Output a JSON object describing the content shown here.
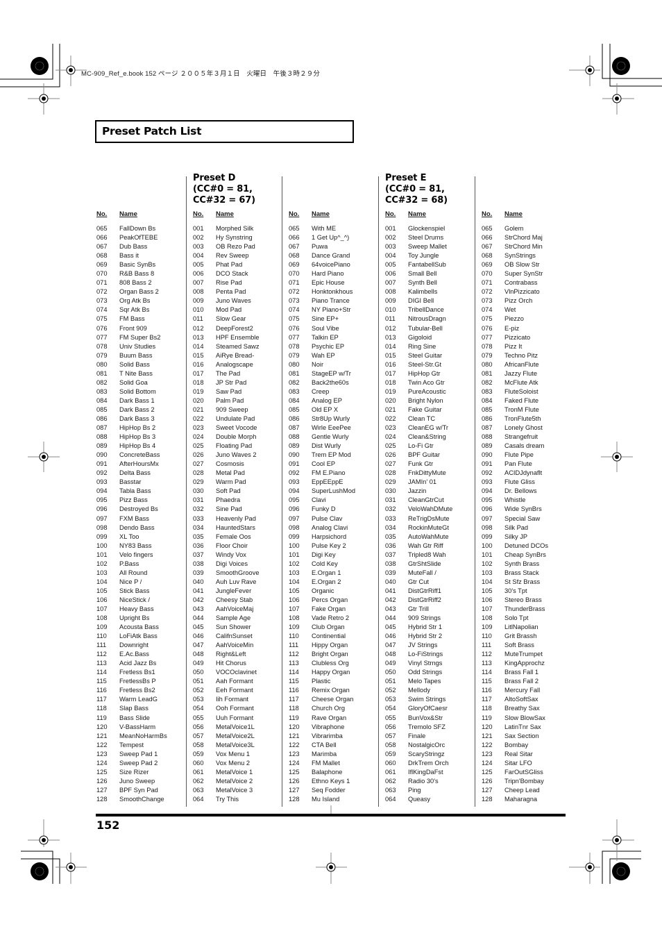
{
  "printer_line": "MC-909_Ref_e.book  152 ページ  ２００５年３月１日　火曜日　午後３時２９分",
  "section_title": "Preset Patch List",
  "page_number": "152",
  "column_headers": {
    "no": "No.",
    "name": "Name"
  },
  "presets": [
    {
      "title_line1": "Preset D",
      "title_line2": "(CC#0 = 81,",
      "title_line3": "CC#32 = 67)"
    },
    {
      "title_line1": "Preset E",
      "title_line2": "(CC#0 = 81,",
      "title_line3": "CC#32 = 68)"
    }
  ],
  "columns": [
    {
      "start": 65,
      "names": [
        "FallDown Bs",
        "PeakOfTEBE",
        "Dub Bass",
        "Bass it",
        "Basic SynBs",
        "R&B Bass 8",
        "808 Bass 2",
        "Organ Bass 2",
        "Org Atk Bs",
        "Sqr Atk Bs",
        "FM Bass",
        "Front 909",
        "FM Super Bs2",
        "Univ Studies",
        "Buum Bass",
        "Solid Bass",
        "T Nite Bass",
        "Solid Goa",
        "Solid Bottom",
        "Dark Bass 1",
        "Dark Bass 2",
        "Dark Bass 3",
        "HipHop Bs 2",
        "HipHop Bs 3",
        "HipHop Bs 4",
        "ConcreteBass",
        "AfterHoursMx",
        "Delta Bass",
        "Basstar",
        "Tabla Bass",
        "Pizz Bass",
        "Destroyed Bs",
        "FXM Bass",
        "Dendo Bass",
        "XL Too",
        "NY83 Bass",
        "Velo fingers",
        "P.Bass",
        "All Round",
        "Nice P /",
        "Stick Bass",
        "NiceStick /",
        "Heavy Bass",
        "Upright Bs",
        "Acousta Bass",
        "LoFiAtk Bass",
        "Downright",
        "E.Ac.Bass",
        "Acid Jazz Bs",
        "Fretless Bs1",
        "FretlessBs P",
        "Fretless Bs2",
        "Warm LeadG",
        "Slap Bass",
        "Bass Slide",
        "V-BassHarm",
        "MeanNoHarmBs",
        "Tempest",
        "Sweep Pad 1",
        "Sweep Pad 2",
        "Size Rizer",
        "Juno Sweep",
        "BPF Syn Pad",
        "SmoothChange"
      ]
    },
    {
      "start": 1,
      "names": [
        "Morphed Silk",
        "Hy Synstring",
        "OB Rezo Pad",
        "Rev Sweep",
        "Phat Pad",
        "DCO Stack",
        "Rise Pad",
        "Penta Pad",
        "Juno Waves",
        "Mod Pad",
        "Slow Gear",
        "DeepForest2",
        "HPF Ensemble",
        "Steamed Sawz",
        "AiRye Bread-",
        "Analogscape",
        "The Pad",
        "JP Str Pad",
        "Saw Pad",
        "Palm Pad",
        "909 Sweep",
        "Undulate Pad",
        "Sweet Vocode",
        "Double Morph",
        "Floating Pad",
        "Juno Waves 2",
        "Cosmosis",
        "Metal Pad",
        "Warm Pad",
        "Soft Pad",
        "Phaedra",
        "Sine Pad",
        "Heavenly Pad",
        "HauntedStars",
        "Female Oos",
        "Floor Choir",
        "Windy Vox",
        "Digi Voices",
        "SmoothGroove",
        "Auh Luv Rave",
        "JungleFever",
        "Cheesy Stab",
        "AahVoiceMaj",
        "Sample Age",
        "Sun Shower",
        "CalifnSunset",
        "AahVoiceMin",
        "Right&Left",
        "Hit Chorus",
        "VOCOclavinet",
        "Aah Formant",
        "Eeh Formant",
        "Iih Formant",
        "Ooh Formant",
        "Uuh Formant",
        "MetalVoice1L",
        "MetalVoice2L",
        "MetalVoice3L",
        "Vox Menu 1",
        "Vox Menu 2",
        "MetalVoice 1",
        "MetalVoice 2",
        "MetalVoice 3",
        "Try This"
      ]
    },
    {
      "start": 65,
      "names": [
        "With ME",
        "1 Get Up^_^)",
        "Puwa",
        "Dance Grand",
        "64voicePiano",
        "Hard Piano",
        "Epic House",
        "Honktonkhous",
        "Piano Trance",
        "NY Piano+Str",
        "Sine EP+",
        "Soul Vibe",
        "Talkin EP",
        "Psychic EP",
        "Wah EP",
        "Noir",
        "StageEP w/Tr",
        "Back2the60s",
        "Creep",
        "Analog EP",
        "Old EP X",
        "Str8Up Wurly",
        "Wirle EeePee",
        "Gentle Wurly",
        "Dist Wurly",
        "Trem EP Mod",
        "Cool EP",
        "FM E.Piano",
        "EppEEppE",
        "SuperLushMod",
        "Clavi",
        "Funky D",
        "Pulse Clav",
        "Analog Clavi",
        "Harpsichord",
        "Pulse Key 2",
        "Digi Key",
        "Cold Key",
        "E.Organ 1",
        "E.Organ 2",
        "Organic",
        "Percs Organ",
        "Fake Organ",
        "Vade Retro 2",
        "Club Organ",
        "Continential",
        "Hippy Organ",
        "Bright Organ",
        "Clubless Org",
        "Happy Organ",
        "Plastic",
        "Remix Organ",
        "Cheese Organ",
        "Church Org",
        "Rave Organ",
        "Vibraphone",
        "Vibrarimba",
        "CTA Bell",
        "Marimba",
        "FM Mallet",
        "Balaphone",
        "Ethno Keys 1",
        "Seq Fodder",
        "Mu Island"
      ]
    },
    {
      "start": 1,
      "names": [
        "Glockenspiel",
        "Steel Drums",
        "Sweep Mallet",
        "Toy Jungle",
        "FantabellSub",
        "Small Bell",
        "Synth Bell",
        "Kalimbells",
        "DIGI Bell",
        "TribellDance",
        "NitrousDragn",
        "Tubular-Bell",
        "Gigoloid",
        "Ring Sine",
        "Steel Guitar",
        "Steel-Str.Gt",
        "HipHop Gtr",
        "Twin Aco Gtr",
        "PureAcoustic",
        "Bright Nylon",
        "Fake Guitar",
        "Clean TC",
        "CleanEG w/Tr",
        "Clean&String",
        "Lo-Fi Gtr",
        "BPF Guitar",
        "Funk Gtr",
        "FnkDittyMute",
        "JAMIn' 01",
        "Jazzin",
        "CleanGtrCut",
        "VeloWahDMute",
        "ReTrigDsMute",
        "RockinMuteGt",
        "AutoWahMute",
        "Wah Gtr Riff",
        "Tripled8 Wah",
        "GtrShtSlide",
        "MuteFall /",
        "Gtr Cut",
        "DistGtrRiff1",
        "DistGtrRiff2",
        "Gtr Trill",
        "909 Strings",
        "Hybrid Str 1",
        "Hybrid Str 2",
        "JV Strings",
        "Lo-FiStrings",
        "Vinyl Strngs",
        "Odd Strings",
        "Melo Tapes",
        "Mellody",
        "Swim Strings",
        "GloryOfCaesr",
        "BunVox&Str",
        "Tremolo SFZ",
        "Finale",
        "NostalgicOrc",
        "ScaryStringz",
        "DrkTrem Orch",
        "IflKingDaFst",
        "Radio 30's",
        "Ping",
        "Queasy"
      ]
    },
    {
      "start": 65,
      "names": [
        "Golem",
        "StrChord Maj",
        "StrChord Min",
        "SynStrings",
        "OB Slow Str",
        "Super SynStr",
        "Contrabass",
        "VlnPizzicato",
        "Pizz Orch",
        "Wet",
        "Piezzo",
        "E-piz",
        "Pizzicato",
        "Pizz It",
        "Techno Pitz",
        "AfricanFlute",
        "Jazzy Flute",
        "McFlute Atk",
        "FluteSoloist",
        "Faked Flute",
        "TronM Flute",
        "TronFlute5th",
        "Lonely Ghost",
        "Strangefruit",
        "Casals dream",
        "Flute Pipe",
        "Pan Flute",
        "ACIDJdynaflt",
        "Flute Gliss",
        "Dr. Bellows",
        "Whistle",
        "Wide SynBrs",
        "Special Saw",
        "Silk Pad",
        "Silky JP",
        "Detuned DCOs",
        "Cheap SynBrs",
        "Synth Brass",
        "Brass Stack",
        "St Sfz Brass",
        "30's Tpt",
        "Stereo Brass",
        "ThunderBrass",
        "Solo Tpt",
        "LitlNapolian",
        "Grit Brassh",
        "Soft Brass",
        "MuteTrumpet",
        "KingApprochz",
        "Brass Fall 1",
        "Brass Fall 2",
        "Mercury Fall",
        "AltoSoftSax",
        "Breathy Sax",
        "Slow BlowSax",
        "LatinTnr Sax",
        "Sax Section",
        "Bombay",
        "Real Sitar",
        "Sitar LFO",
        "FarOutSGliss",
        "Tripn'Bombay",
        "Cheep Lead",
        "Maharagna"
      ]
    }
  ]
}
